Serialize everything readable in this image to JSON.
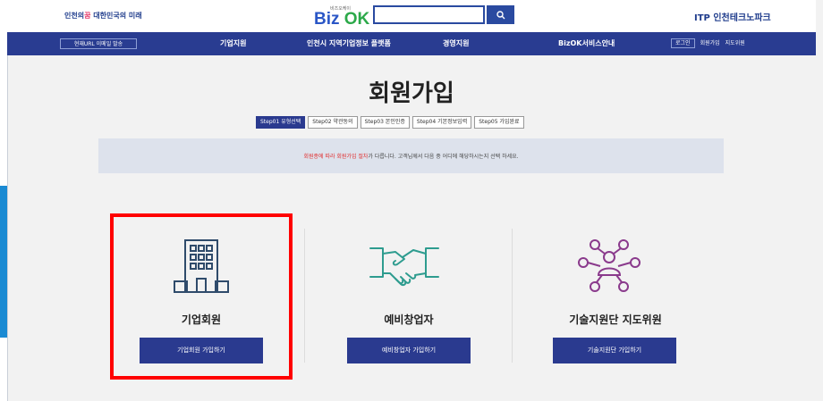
{
  "header": {
    "left_logo_a": "인천의",
    "left_logo_b": "꿈",
    "left_logo_c": " 대한민국의 미래",
    "bizok_small": "비즈오케이",
    "bizok_biz": "Biz",
    "bizok_ok": "OK",
    "search_value": "",
    "search_icon": "search-icon",
    "itp_logo": "ITP 인천테크노파크"
  },
  "nav": {
    "url_button": "현재URL 이메일 발송",
    "menu": [
      "기업지원",
      "인천시 지역기업정보 플랫폼",
      "경영지원",
      "BizOK서비스안내"
    ],
    "util": [
      "로그인",
      "회원가입",
      "지도위원"
    ]
  },
  "main": {
    "title": "회원가입",
    "steps": [
      "Step01 유형선택",
      "Step02 약관동의",
      "Step03 본인인증",
      "Step04 기본정보입력",
      "Step05 가입완료"
    ],
    "info_red": "회원종에 따라 회원가입 절차",
    "info_rest": "가 다릅니다. 고객님께서 다음 중 어디에 해당하시는지 선택 하세요.",
    "cards": [
      {
        "title": "기업회원",
        "button": "기업회원 가입하기",
        "icon": "building-icon"
      },
      {
        "title": "예비창업자",
        "button": "예비창업자 가입하기",
        "icon": "handshake-icon"
      },
      {
        "title": "기술지원단 지도위원",
        "button": "기술지원단 가입하기",
        "icon": "network-people-icon"
      }
    ]
  },
  "colors": {
    "nav_bg": "#293c91",
    "accent": "#2a3a8f",
    "icon": "#2f4b6b",
    "highlight": "#ff0000"
  }
}
